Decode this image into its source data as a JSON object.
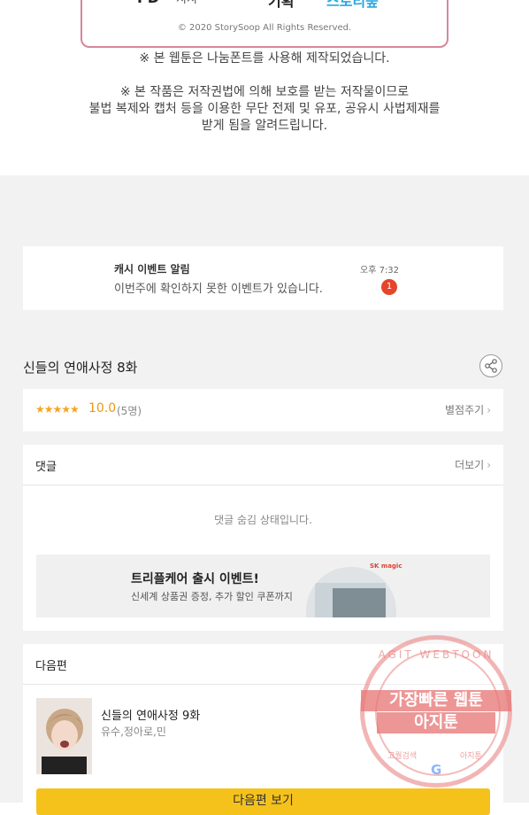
{
  "credit": {
    "left_fragment": "PD",
    "mid_fragment": "지지",
    "right_fragment": "기획",
    "logo_fragment": "스토리숲",
    "copyright": "© 2020 StorySoop All Rights Reserved."
  },
  "notices": {
    "font_notice": "※ 본 웹툰은 나눔폰트를 사용해 제작되었습니다.",
    "copyright_line1": "※ 본 작품은 저작권법에 의해 보호를 받는 저작물이므로",
    "copyright_line2": "불법 복제와 캡처 등을 이용한 무단 전제 및 유포, 공유시 사법제재를",
    "copyright_line3": "받게 됨을 알려드립니다."
  },
  "notification": {
    "title": "캐시 이벤트 알림",
    "time": "오후 7:32",
    "message": "이번주에 확인하지 못한 이벤트가 있습니다.",
    "badge_count": "1",
    "badge_color": "#e5452b"
  },
  "episode": {
    "title": "신들의 연애사정 8화",
    "share_icon": "share-icon"
  },
  "rating": {
    "stars": "★★★★★",
    "score": "10.0",
    "count": "(5명)",
    "rate_label": "별점주기",
    "star_color": "#f5a623"
  },
  "comments": {
    "header": "댓글",
    "more_label": "더보기",
    "hidden_message": "댓글 숨김 상태입니다."
  },
  "ad": {
    "title": "트리플케어 출시 이벤트!",
    "subtitle": "신세계 상품권 증정, 추가 할인 쿠폰까지",
    "brand": "SK magic"
  },
  "next_episode": {
    "header": "다음편",
    "title": "신들의 연애사정 9화",
    "authors": "유수,정아로,민",
    "button_label": "다음편 보기"
  },
  "watermark": {
    "ring_text": "AGIT WEBTOON",
    "main_line1": "가장빠른 웹툰",
    "main_line2": "아지툰",
    "bottom_left": "고퀄검색",
    "bottom_right": "아지툰",
    "g_logo": "G",
    "color": "#e77878"
  },
  "accent_colors": {
    "button_yellow": "#f5c21b",
    "background_gray": "#f2f2f2",
    "frame_pink": "#d6879a"
  }
}
